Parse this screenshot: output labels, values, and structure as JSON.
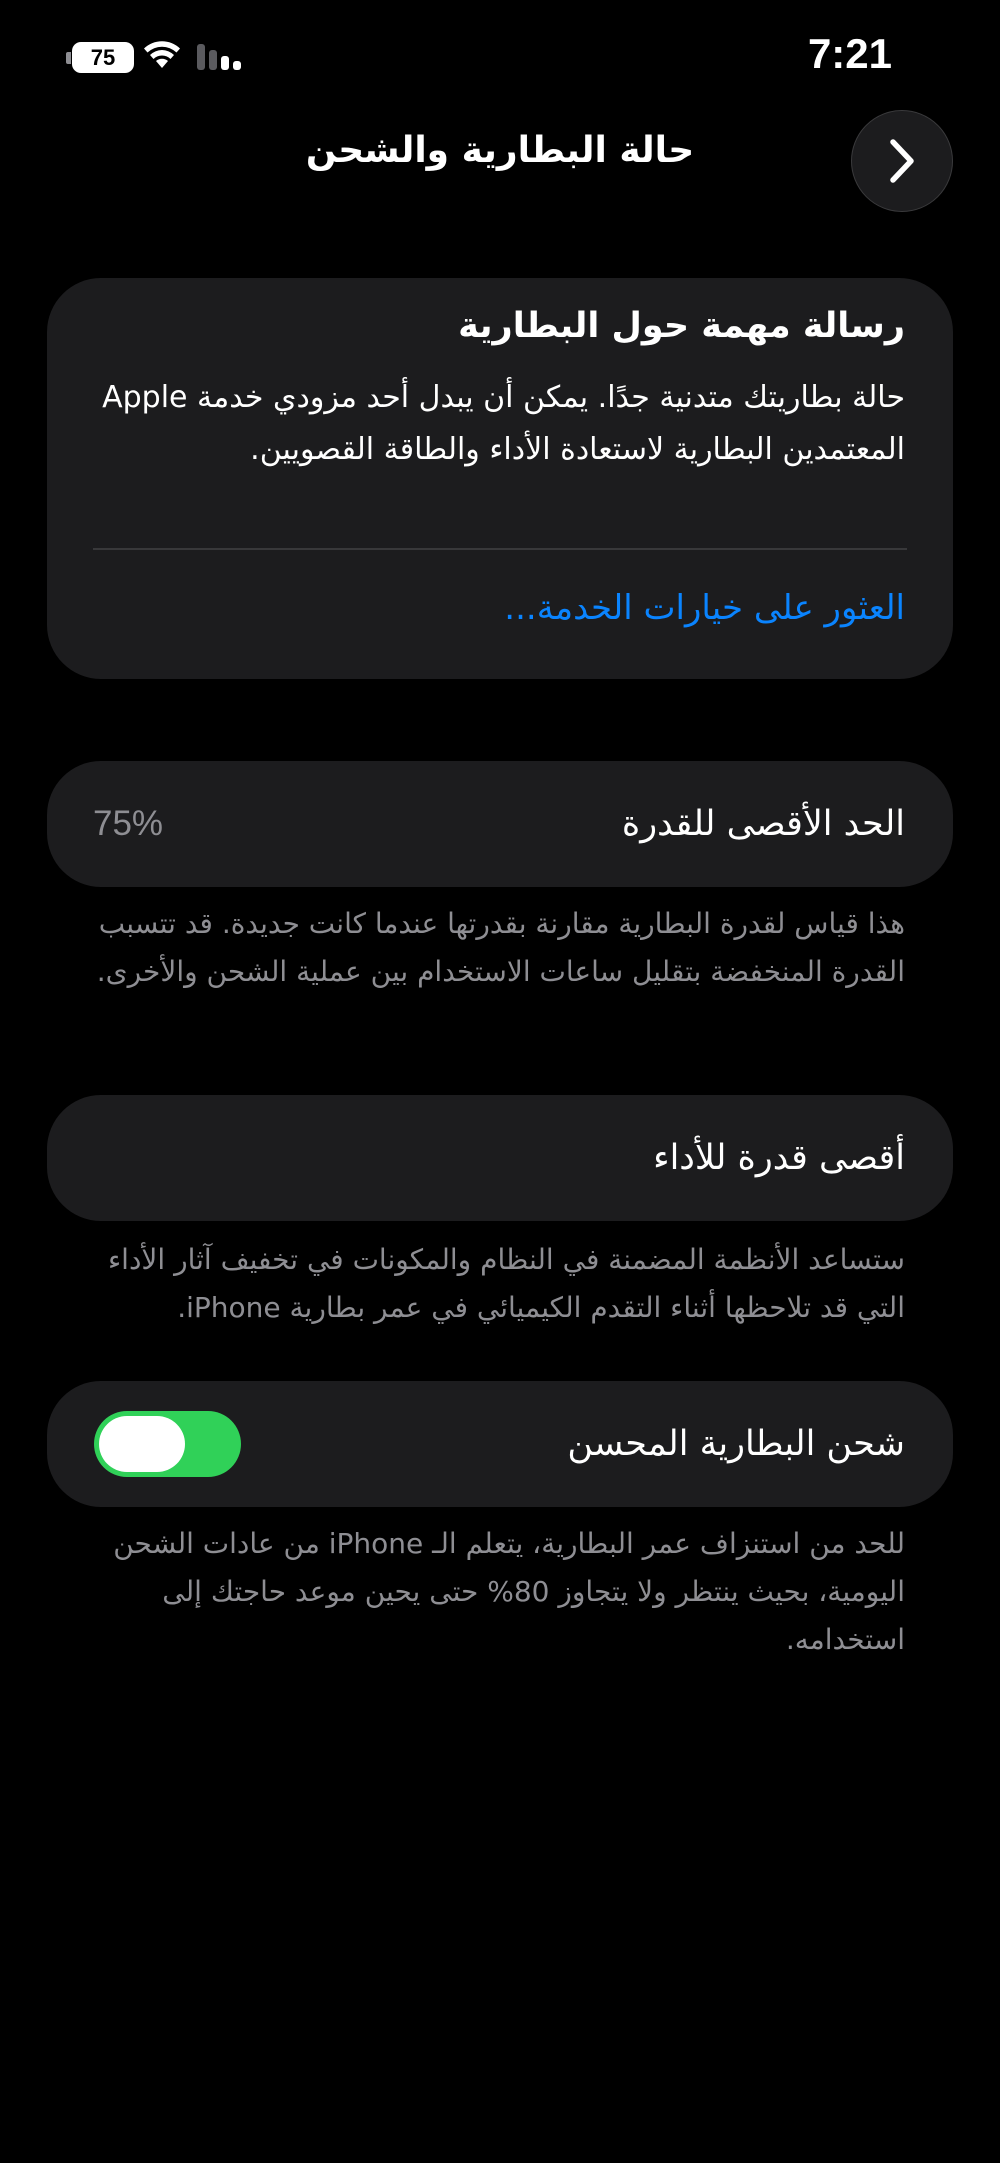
{
  "status_bar": {
    "battery_level": "75",
    "time": "7:21",
    "icons": [
      "battery-icon",
      "wifi-icon",
      "cellular-signal-icon"
    ]
  },
  "nav": {
    "title": "حالة البطارية والشحن",
    "back_icon": "chevron-right-icon"
  },
  "alert": {
    "title": "رسالة مهمة حول البطارية",
    "body": "حالة بطاريتك متدنية جدًا. يمكن أن يبدل أحد مزودي خدمة Apple المعتمدين البطارية لاستعادة الأداء والطاقة القصويين.",
    "link": "العثور على خيارات الخدمة..."
  },
  "capacity": {
    "label": "الحد الأقصى للقدرة",
    "value": "75%",
    "footnote": "هذا قياس لقدرة البطارية مقارنة بقدرتها عندما كانت جديدة. قد تتسبب القدرة المنخفضة بتقليل ساعات الاستخدام بين عملية الشحن والأخرى."
  },
  "performance": {
    "label": "أقصى قدرة للأداء",
    "footnote": "ستساعد الأنظمة المضمنة في النظام والمكونات في تخفيف آثار الأداء التي قد تلاحظها أثناء التقدم الكيميائي في عمر بطارية iPhone."
  },
  "optimized_charging": {
    "label": "شحن البطارية المحسن",
    "enabled": true,
    "footnote": "للحد من استنزاف عمر البطارية، يتعلم الـ iPhone من عادات الشحن اليومية، بحيث ينتظر ولا يتجاوز 80% حتى يحين موعد حاجتك إلى استخدامه."
  },
  "colors": {
    "background": "#000000",
    "card": "#1c1c1e",
    "link": "#0a84ff",
    "toggle_on": "#30d158",
    "secondary_text": "#8e8e93"
  }
}
